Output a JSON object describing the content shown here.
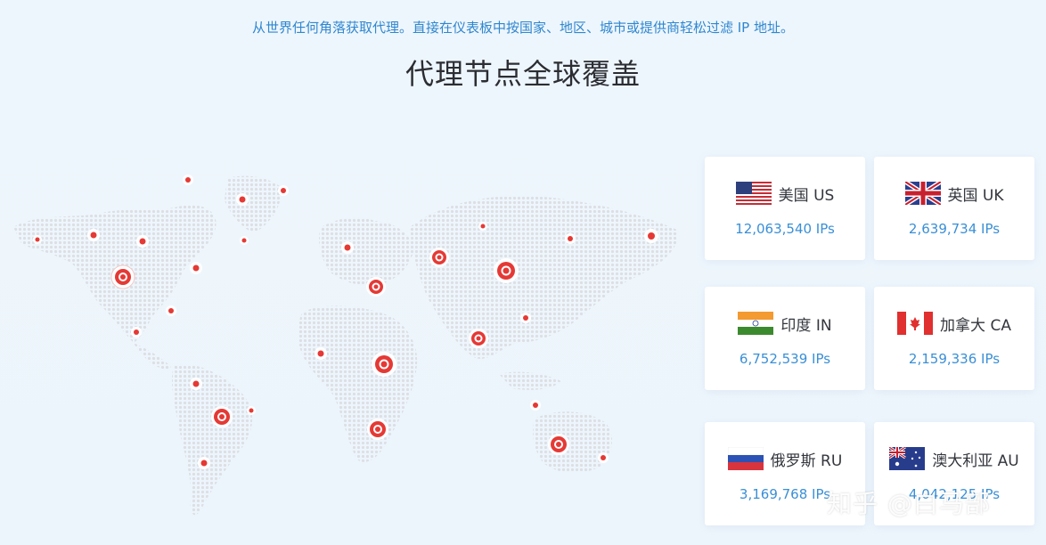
{
  "header": {
    "subtitle": "从世界任何角落获取代理。直接在仪表板中按国家、地区、城市或提供商轻松过滤 IP 地址。",
    "title": "代理节点全球覆盖"
  },
  "colors": {
    "marker": "#e53935",
    "ips_text": "#3a8fd6",
    "subtitle_text": "#2f87cf"
  },
  "countries": [
    {
      "name": "美国 US",
      "ips": "12,063,540 IPs",
      "flag": "us-flag-icon"
    },
    {
      "name": "英国 UK",
      "ips": "2,639,734 IPs",
      "flag": "uk-flag-icon"
    },
    {
      "name": "印度 IN",
      "ips": "6,752,539 IPs",
      "flag": "in-flag-icon"
    },
    {
      "name": "加拿大 CA",
      "ips": "2,159,336 IPs",
      "flag": "ca-flag-icon"
    },
    {
      "name": "俄罗斯 RU",
      "ips": "3,169,768 IPs",
      "flag": "ru-flag-icon"
    },
    {
      "name": "澳大利亚 AU",
      "ips": "4,042,125 IPs",
      "flag": "au-flag-icon"
    }
  ],
  "watermark": "知乎 @白马部"
}
